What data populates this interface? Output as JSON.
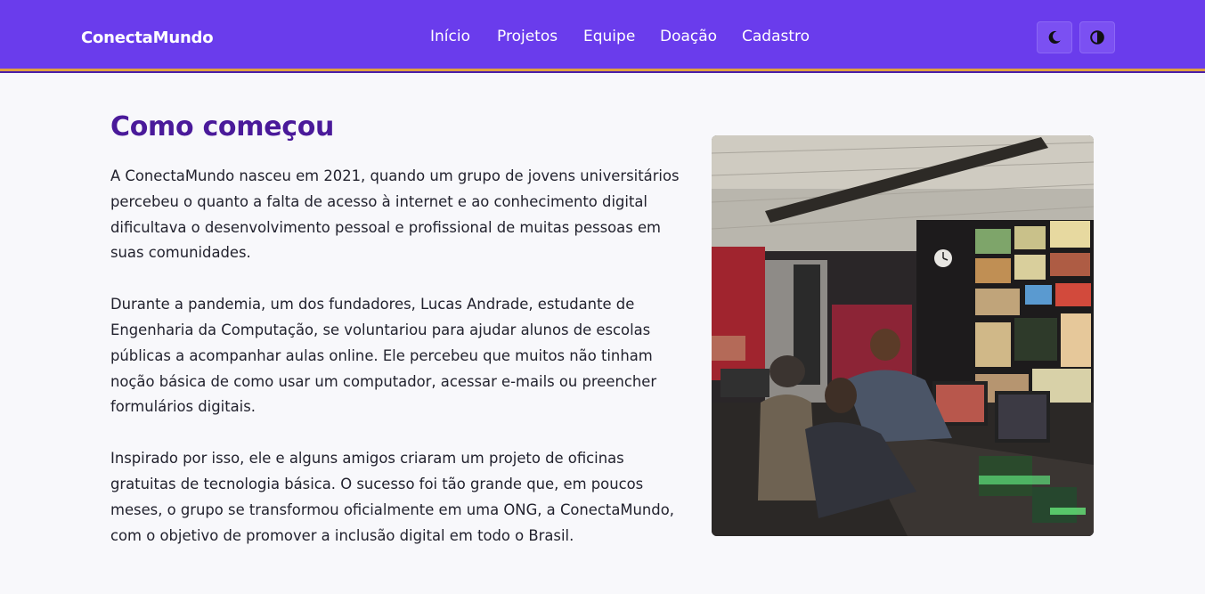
{
  "header": {
    "brand": "ConectaMundo",
    "nav": [
      "Início",
      "Projetos",
      "Equipe",
      "Doação",
      "Cadastro"
    ],
    "buttons": [
      {
        "icon": "moon-icon"
      },
      {
        "icon": "contrast-icon"
      }
    ]
  },
  "main": {
    "title": "Como começou",
    "paragraphs": [
      "A ConectaMundo nasceu em 2021, quando um grupo de jovens universitários percebeu o quanto a falta de acesso à internet e ao conhecimento digital dificultava o desenvolvimento pessoal e profissional de muitas pessoas em suas comunidades.",
      "Durante a pandemia, um dos fundadores, Lucas Andrade, estudante de Engenharia da Computação, se voluntariou para ajudar alunos de escolas públicas a acompanhar aulas online. Ele percebeu que muitos não tinham noção básica de como usar um computador, acessar e-mails ou preencher formulários digitais.",
      "Inspirado por isso, ele e alguns amigos criaram um projeto de oficinas gratuitas de tecnologia básica. O sucesso foi tão grande que, em poucos meses, o grupo se transformou oficialmente em uma ONG, a ConectaMundo, com o objetivo de promover a inclusão digital em todo o Brasil."
    ]
  },
  "colors": {
    "header_bg": "#6a3cec",
    "header_border": "#e0a040",
    "title": "#4a1a9a",
    "page_bg": "#f8f8fb"
  }
}
